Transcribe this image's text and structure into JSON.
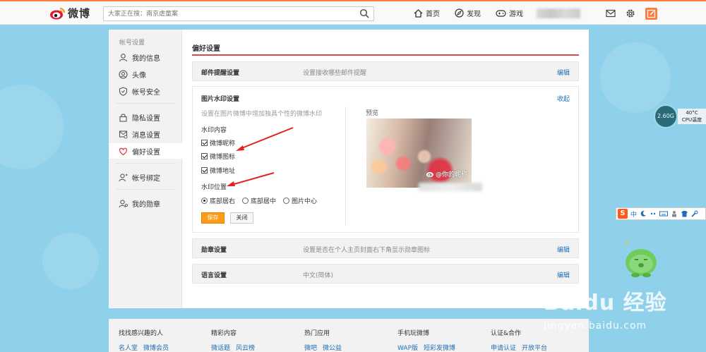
{
  "header": {
    "logo_text": "微博",
    "search_placeholder": "大家正在搜：南京虐童案",
    "nav": [
      {
        "label": "首页"
      },
      {
        "label": "发现"
      },
      {
        "label": "游戏"
      }
    ]
  },
  "sidebar": {
    "title": "帐号设置",
    "items": [
      {
        "label": "我的信息"
      },
      {
        "label": "头像"
      },
      {
        "label": "帐号安全"
      },
      {
        "label": "隐私设置"
      },
      {
        "label": "消息设置"
      },
      {
        "label": "偏好设置"
      },
      {
        "label": "帐号绑定"
      },
      {
        "label": "我的勋章"
      }
    ]
  },
  "content": {
    "title": "偏好设置",
    "email_row": {
      "title": "邮件提醒设置",
      "desc": "设置接收哪些邮件提醒",
      "link": "编辑"
    },
    "watermark": {
      "title": "图片水印设置",
      "link": "收起",
      "desc": "设置在图片微博中增加独具个性的微博水印",
      "content_label": "水印内容",
      "options": [
        {
          "label": "微博昵称",
          "checked": true
        },
        {
          "label": "微博图标",
          "checked": true
        },
        {
          "label": "微博地址",
          "checked": true
        }
      ],
      "position_label": "水印位置",
      "positions": [
        {
          "label": "底部居右",
          "selected": true
        },
        {
          "label": "底部居中",
          "selected": false
        },
        {
          "label": "图片中心",
          "selected": false
        }
      ],
      "save_label": "保存",
      "close_label": "关闭",
      "preview_label": "预览",
      "preview_watermark": "@你的昵称"
    },
    "medal_row": {
      "title": "勋章设置",
      "desc": "设置是否在个人主页封面右下角显示勋章图标",
      "link": "编辑"
    },
    "lang_row": {
      "title": "语言设置",
      "desc": "中文(简体)",
      "link": "编辑"
    }
  },
  "footer": {
    "columns": [
      {
        "head": "找找感兴趣的人",
        "links": [
          "名人堂",
          "微博会员"
        ]
      },
      {
        "head": "精彩内容",
        "links": [
          "微话题",
          "风云榜"
        ]
      },
      {
        "head": "热门应用",
        "links": [
          "微吧",
          "微公益"
        ]
      },
      {
        "head": "手机玩微博",
        "links": [
          "WAP版",
          "短彩发微博"
        ]
      },
      {
        "head": "认证&合作",
        "links": [
          "申请认证",
          "开放平台"
        ]
      }
    ]
  },
  "widgets": {
    "cpu_value": "2.60G",
    "cpu_temp": "40°C",
    "cpu_label": "CPU温度",
    "ime_label": "中",
    "baidu_text": "Baidu 经验",
    "baidu_url": "jingyan.baidu.com"
  },
  "colors": {
    "accent": "#fa7d3c",
    "link": "#1f6fb5",
    "save": "#ff9a16",
    "title_line": "#d14c4c"
  }
}
